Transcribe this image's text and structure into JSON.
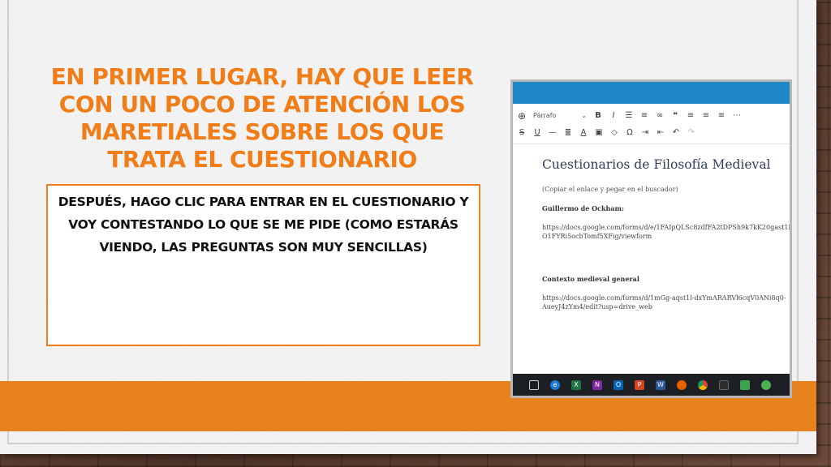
{
  "slide": {
    "title": "En primer lugar, hay que leer con un poco de atención los maretiales sobre los que trata el cuestionario",
    "body": "Después, hago clic para entrar en el cuestionario y voy contestando lo que se me pide (como estarás viendo, las preguntas son muy sencillas)"
  },
  "screenshot": {
    "toolbar": {
      "paragraph_select": "Párrafo",
      "row1_icons": [
        "add-icon",
        "bold-icon",
        "italic-icon",
        "bullet-list-icon",
        "numbered-list-icon",
        "quote-icon",
        "align-left-icon",
        "align-center-icon",
        "align-right-icon",
        "link-icon",
        "more-icon"
      ],
      "row2_icons": [
        "strikethrough-icon",
        "underline-icon",
        "horizontal-line-icon",
        "justify-icon",
        "text-color-icon",
        "paste-text-icon",
        "clear-format-icon",
        "special-char-icon",
        "indent-icon",
        "outdent-icon",
        "undo-icon",
        "redo-icon"
      ]
    },
    "document": {
      "heading": "Cuestionarios de Filosofía Medieval",
      "instruction": "(Copiar el enlace y pegar en el buscador)",
      "section1_title": "Guillermo de Ockham:",
      "section1_link_line1": "https://docs.google.com/forms/d/e/1FAIpQLSc8zdfFA2tDPSh9k7kK20gast1Ix",
      "section1_link_line2": "O1FYRi5ocbTomf5XFig/viewform",
      "section2_title": "Contexto medieval general",
      "section2_link_line1": "https://docs.google.com/forms/d/1mGg-aqst1l-dxYmARARVl6cqV0ANi8q0-",
      "section2_link_line2": "AueyJ4zYm4/edit?usp=drive_web"
    },
    "taskbar": {
      "icons": [
        "task-view-icon",
        "edge-icon",
        "excel-icon",
        "onenote-icon",
        "outlook-icon",
        "powerpoint-icon",
        "word-icon",
        "firefox-icon",
        "chrome-icon",
        "app-icon",
        "app-green-icon",
        "app-dark-icon"
      ]
    }
  },
  "colors": {
    "accent_orange": "#f07d17",
    "band_orange": "#e8821f",
    "editor_blue": "#1e88c8"
  }
}
